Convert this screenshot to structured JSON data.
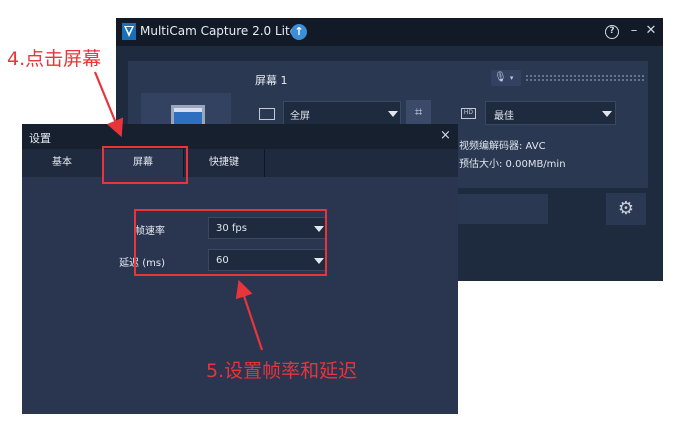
{
  "multicam": {
    "title": "MultiCam Capture 2.0 Lite",
    "update_icon": "up-arrow-icon",
    "help_glyph": "?",
    "min_glyph": "–",
    "close_glyph": "✕",
    "screen_label": "屏幕 1",
    "mic_glyph": "🎙",
    "fullscreen_value": "全屏",
    "crop_glyph": "⌗",
    "quality_badge": "HD",
    "quality_value": "最佳",
    "codec_text": "视频编解码器: AVC",
    "size_text": "预估大小: 0.00MB/min",
    "settings_glyph": "⚙"
  },
  "dialog": {
    "title": "设置",
    "close_glyph": "×",
    "tabs": [
      {
        "label": "基本"
      },
      {
        "label": "屏幕"
      },
      {
        "label": "快捷键"
      }
    ],
    "framerate_label": "帧速率",
    "framerate_value": "30 fps",
    "delay_label": "延迟 (ms)",
    "delay_value": "60"
  },
  "annotations": {
    "step4": "4.点击屏幕",
    "step5": "5.设置帧率和延迟",
    "color": "#e8343b"
  }
}
